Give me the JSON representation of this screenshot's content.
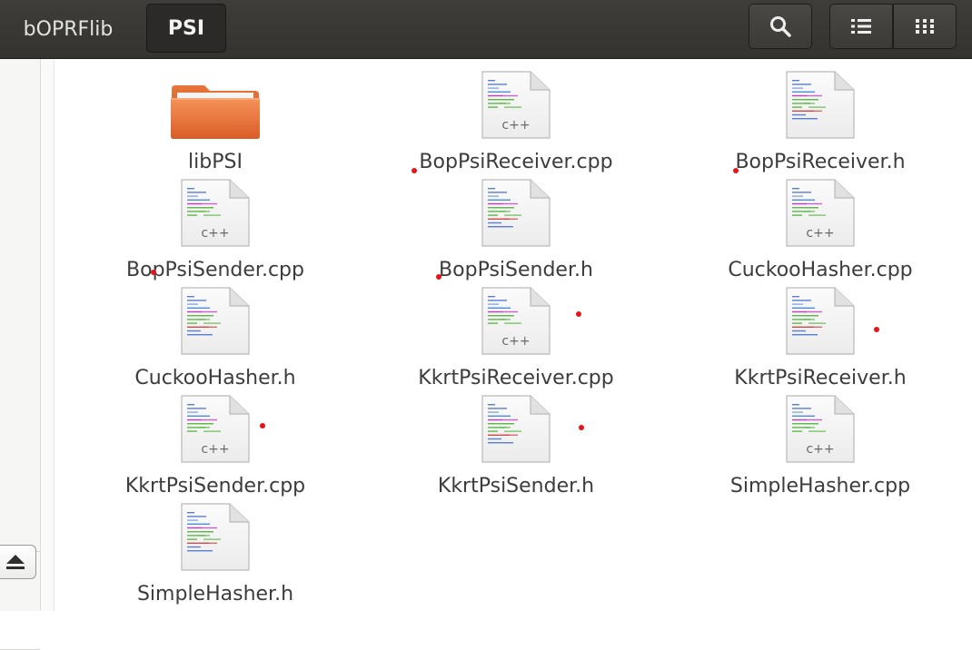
{
  "header": {
    "breadcrumb": [
      "bOPRFlib",
      "PSI"
    ],
    "buttons": [
      "search-icon",
      "list-view-icon",
      "grid-view-icon"
    ]
  },
  "sidebar": {
    "eject_icon": "eject-icon"
  },
  "files": [
    {
      "name": "libPSI",
      "type": "folder"
    },
    {
      "name": "BopPsiReceiver.cpp",
      "type": "cpp"
    },
    {
      "name": "BopPsiReceiver.h",
      "type": "h"
    },
    {
      "name": "BopPsiSender.cpp",
      "type": "cpp"
    },
    {
      "name": "BopPsiSender.h",
      "type": "h"
    },
    {
      "name": "CuckooHasher.cpp",
      "type": "cpp"
    },
    {
      "name": "CuckooHasher.h",
      "type": "h"
    },
    {
      "name": "KkrtPsiReceiver.cpp",
      "type": "cpp"
    },
    {
      "name": "KkrtPsiReceiver.h",
      "type": "h"
    },
    {
      "name": "KkrtPsiSender.cpp",
      "type": "cpp"
    },
    {
      "name": "KkrtPsiSender.h",
      "type": "h"
    },
    {
      "name": "SimpleHasher.cpp",
      "type": "cpp"
    },
    {
      "name": "SimpleHasher.h",
      "type": "h"
    }
  ],
  "colors": {
    "header_bg": "#3c3b37",
    "folder_orange": "#f07c3a",
    "marker_red": "#e8141a"
  }
}
